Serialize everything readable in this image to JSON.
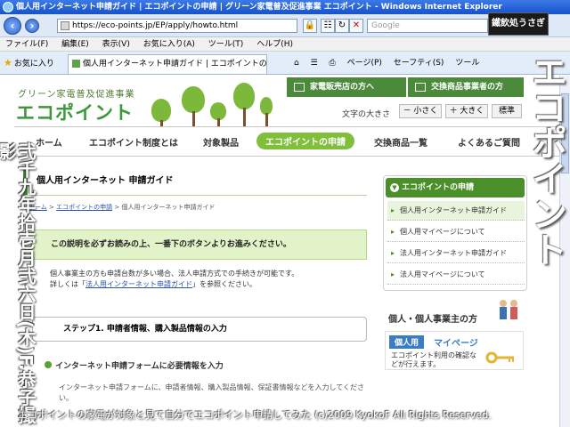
{
  "browser": {
    "title": "個人用インターネット申請ガイド | エコポイントの申請 | グリーン家電普及促進事業 エコポイント - Windows Internet Explorer",
    "url": "https://eco-points.jp/EP/apply/howto.html",
    "search_placeholder": "Google",
    "menu": [
      "ファイル(F)",
      "編集(E)",
      "表示(V)",
      "お気に入り(A)",
      "ツール(T)",
      "ヘルプ(H)"
    ],
    "favorites_label": "お気に入り",
    "tab_title": "個人用インターネット申請ガイド | エコポイントの申請 | ...",
    "commands": [
      "ページ(P)",
      "セーフティ(S)",
      "ツール"
    ]
  },
  "site": {
    "subtitle": "グリーン家電普及促進事業",
    "logo": "エコポイント",
    "btn_retail": "家電販売店の方へ",
    "btn_exchange": "交換商品事業者の方",
    "font_size_label": "文字の大きさ",
    "font_small": "－ 小さく",
    "font_large": "＋ 大きく",
    "font_std": "標準"
  },
  "gnav": [
    "ホーム",
    "エコポイント制度とは",
    "対象製品",
    "エコポイントの申請",
    "交換商品一覧",
    "よくあるご質問"
  ],
  "main": {
    "title": "個人用インターネット 申請ガイド",
    "crumb_home": "ホーム",
    "crumb_apply": "エコポイントの申請",
    "crumb_current": "個人用インターネット申請ガイド",
    "notice": "この説明を必ずお読みの上、一番下のボタンよりお進みください。",
    "para_line1": "個人事業主の方も申請台数が多い場合、法人申請方式での手続きが可能です。",
    "para_line2_pre": "詳しくは「",
    "para_link": "法人用インターネット申請ガイド",
    "para_line2_post": "」を参照ください。",
    "step1": "ステップ1. 申請者情報、購入製品情報の入力",
    "step2": "インターネット申請フォームに必要情報を入力",
    "para2": "インターネット申請フォームに、申請者情報、購入製品情報、保証書情報などを入力してください。"
  },
  "sidebar": {
    "heading": "エコポイントの申請",
    "items": [
      "個人用インターネット申請ガイド",
      "個人用マイページについて",
      "法人用インターネット申請ガイド",
      "法人用マイページについて"
    ],
    "section2_title": "個人・個人事業主の方",
    "mypage_badge": "個人用",
    "mypage_label": "マイページ",
    "mypage_desc": "エコポイント利用の確認などが行えます。"
  },
  "overlay": {
    "vertical_title": "エコポイント",
    "vertical_date": "弐千九年拾壱月弐六日(木)F.恭子撮影",
    "stamp": "鐵飲処うさぎ",
    "caption": "エコポイントの家電が対象と見て自分でエコポイント申請してみた (c)2009 KyokoF All Rights Reserved."
  }
}
